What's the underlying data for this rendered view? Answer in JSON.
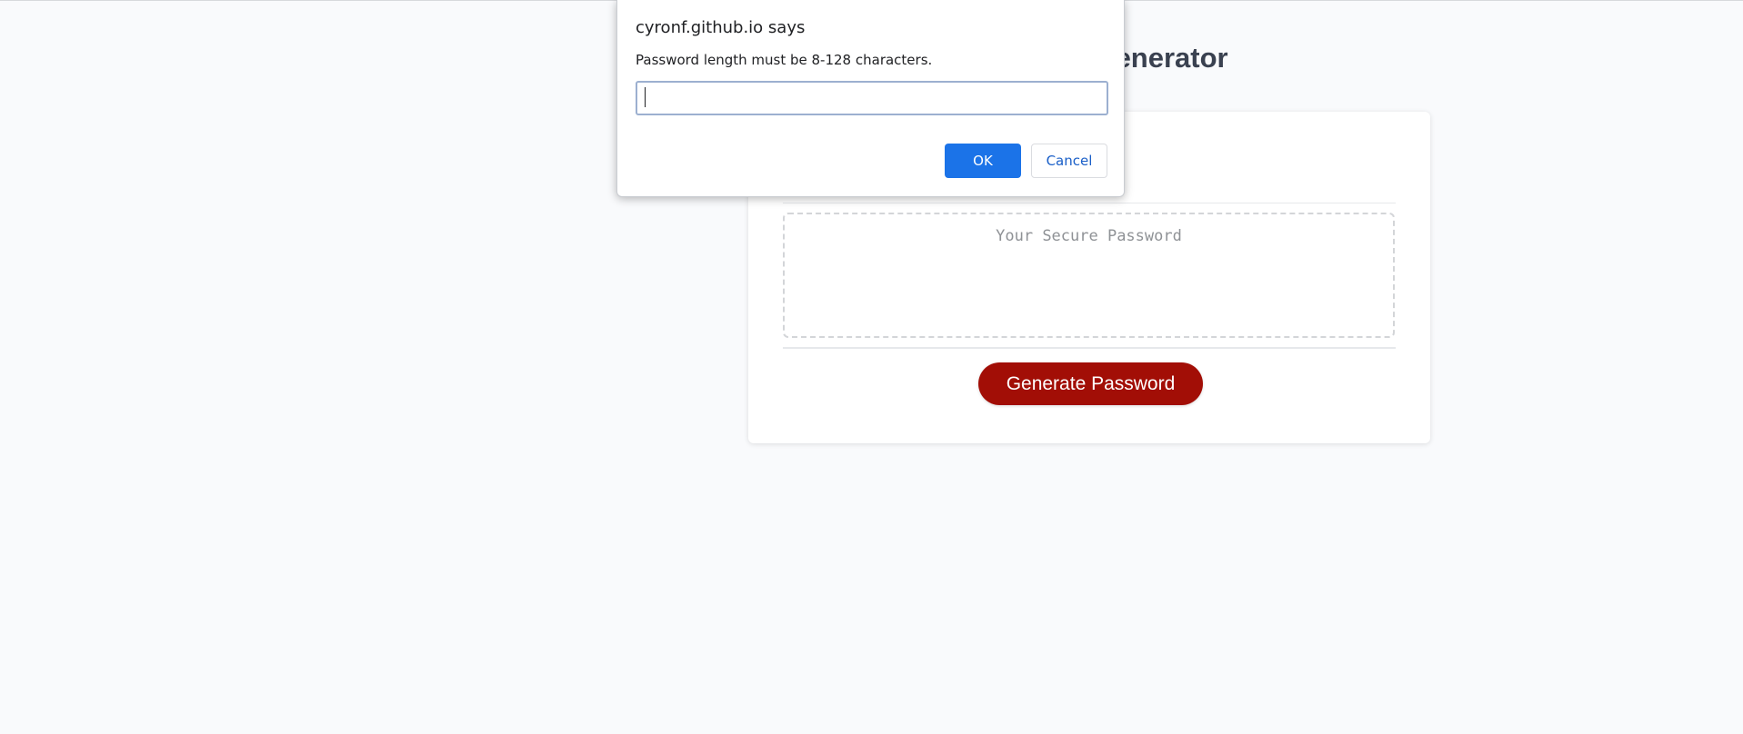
{
  "page": {
    "title": "Password Generator"
  },
  "card": {
    "password_placeholder": "Your Secure Password",
    "generate_button_label": "Generate Password"
  },
  "dialog": {
    "origin": "cyronf.github.io says",
    "message": "Password length must be 8-128 characters.",
    "input_value": "",
    "ok_label": "OK",
    "cancel_label": "Cancel"
  },
  "colors": {
    "background": "#f9fafc",
    "accent_button": "#a20e06",
    "ok_button": "#1b73e8",
    "cancel_text": "#1a5fc8",
    "title_text": "#3a4150"
  }
}
